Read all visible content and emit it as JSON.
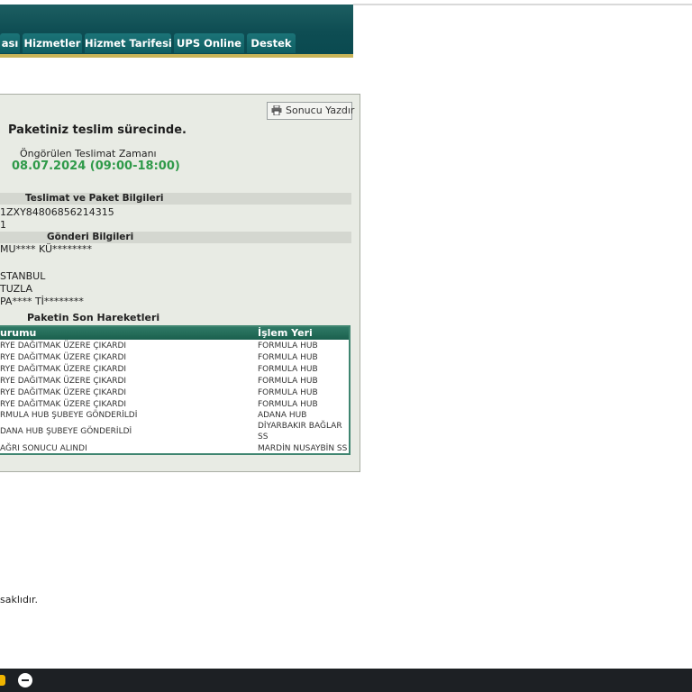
{
  "nav": {
    "tabs": [
      {
        "label": "ası"
      },
      {
        "label": "Hizmetler"
      },
      {
        "label": "Hizmet Tarifesi"
      },
      {
        "label": "UPS Online"
      },
      {
        "label": "Destek"
      }
    ]
  },
  "panel": {
    "print_button": "Sonucu Yazdır",
    "status_title": "Paketiniz teslim sürecinde.",
    "estimated_label": "Öngörülen Teslimat Zamanı",
    "estimated_value": "08.07.2024 (09:00-18:00)",
    "estimated_color": "#2f9a49",
    "delivery_section": {
      "title": "Teslimat ve Paket Bilgileri",
      "lines": [
        "1ZXY84806856214315",
        "1"
      ]
    },
    "shipment_section": {
      "title": "Gönderi Bilgileri",
      "lines": [
        "MU**** KÜ********",
        "",
        "STANBUL",
        "TUZLA",
        "PA**** Tİ********"
      ]
    },
    "movements": {
      "title": "Paketin Son Hareketleri",
      "columns": [
        "urumu",
        "İşlem Yeri"
      ],
      "rows": [
        {
          "status": "RYE DAĞITMAK ÜZERE ÇIKARDI",
          "location": "FORMULA HUB"
        },
        {
          "status": "RYE DAĞITMAK ÜZERE ÇIKARDI",
          "location": "FORMULA HUB"
        },
        {
          "status": "RYE DAĞITMAK ÜZERE ÇIKARDI",
          "location": "FORMULA HUB"
        },
        {
          "status": "RYE DAĞITMAK ÜZERE ÇIKARDI",
          "location": "FORMULA HUB"
        },
        {
          "status": "RYE DAĞITMAK ÜZERE ÇIKARDI",
          "location": "FORMULA HUB"
        },
        {
          "status": "RYE DAĞITMAK ÜZERE ÇIKARDI",
          "location": "FORMULA HUB"
        },
        {
          "status": "RMULA HUB ŞUBEYE GÖNDERİLDİ",
          "location": "ADANA HUB"
        },
        {
          "status": "DANA HUB ŞUBEYE GÖNDERİLDİ",
          "location": "DİYARBAKIR BAĞLAR SS"
        },
        {
          "status": "AĞRI SONUCU ALINDI",
          "location": "MARDİN NUSAYBİN SS"
        }
      ]
    }
  },
  "footer": {
    "text": "saklıdır."
  },
  "taskbar": {
    "icons": [
      "app-icon",
      "minus-circle-icon"
    ]
  },
  "colors": {
    "header_bg": "#0e4d53",
    "tab_bg": "#1b7478",
    "accent_line": "#c8b458",
    "table_border": "#3f8570"
  }
}
